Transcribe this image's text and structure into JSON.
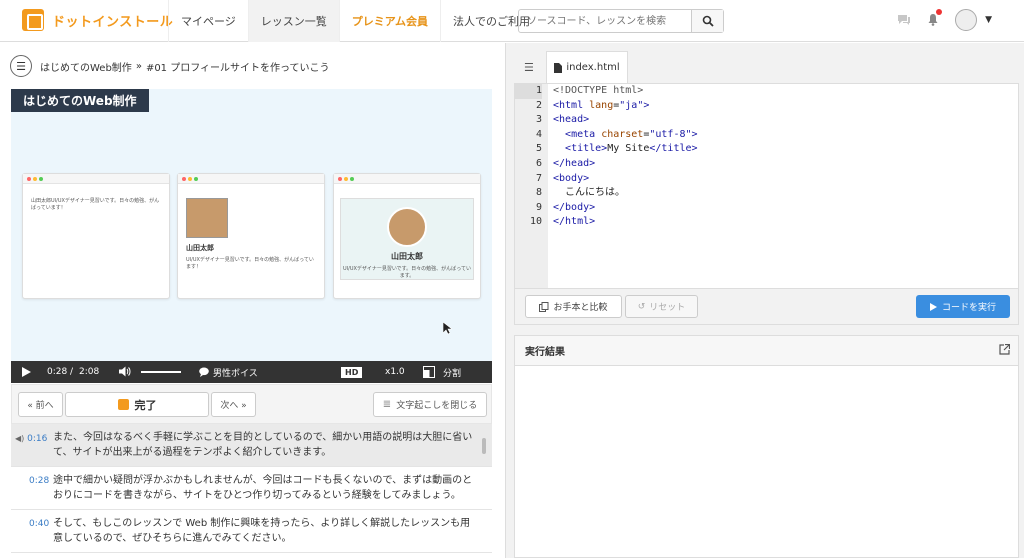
{
  "header": {
    "logo_text": "ドットインストール",
    "nav": [
      {
        "label": "マイページ",
        "active": false,
        "premium": false
      },
      {
        "label": "レッスン一覧",
        "active": true,
        "premium": false
      },
      {
        "label": "プレミアム会員",
        "active": false,
        "premium": true
      },
      {
        "label": "法人でのご利用",
        "active": false,
        "premium": false
      }
    ],
    "search_placeholder": "ソースコード、レッスンを検索"
  },
  "breadcrumb": {
    "course": "はじめてのWeb制作",
    "separator": "»",
    "lesson": "#01 プロフィールサイトを作っていこう"
  },
  "video": {
    "title": "はじめてのWeb制作",
    "card1_text": "山田太郎UI/UXデザイナー見習いです。日々の勉強、がんばっています！",
    "card2_name": "山田太郎",
    "card2_text": "UI/UXデザイナー見習いです。日々の勉強、がんばっています！",
    "card3_name": "山田太郎",
    "card3_text": "UI/UXデザイナー見習いです。日々の勉強、がんばっています。",
    "current_time": "0:28",
    "time_sep": "/",
    "duration": "2:08",
    "voice": "男性ボイス",
    "hd": "HD",
    "speed": "x1.0",
    "split": "分割"
  },
  "lesson_buttons": {
    "prev": "« 前へ",
    "done": "完了",
    "next": "次へ »",
    "close_transcript": "文字起こしを閉じる"
  },
  "transcript": [
    {
      "time": "0:16",
      "text": "また、今回はなるべく手軽に学ぶことを目的としているので、細かい用語の説明は大胆に省いて、サイトが出来上がる過程をテンポよく紹介していきます。",
      "active": true
    },
    {
      "time": "0:28",
      "text": "途中で細かい疑問が浮かぶかもしれませんが、今回はコードも長くないので、まずは動画のとおりにコードを書きながら、サイトをひとつ作り切ってみるという経験をしてみましょう。",
      "active": false
    },
    {
      "time": "0:40",
      "text": "そして、もしこのレッスンで Web 制作に興味を持ったら、より詳しく解説したレッスンも用意しているので、ぜひそちらに進んでみてください。",
      "active": false
    }
  ],
  "editor": {
    "tab_label": "index.html",
    "line_numbers": [
      "1",
      "2",
      "3",
      "4",
      "5",
      "6",
      "7",
      "8",
      "9",
      "10"
    ],
    "buttons": {
      "compare": "お手本と比較",
      "reset": "リセット",
      "run": "コードを実行"
    }
  },
  "result": {
    "title": "実行結果"
  }
}
